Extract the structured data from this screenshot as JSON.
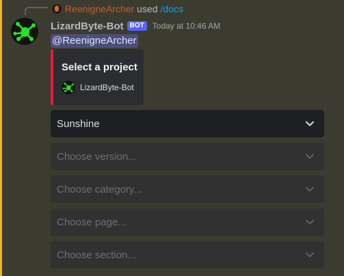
{
  "reply": {
    "user": "ReenigneArcher",
    "used_label": "used",
    "command": "/docs"
  },
  "message": {
    "username": "LizardByte-Bot",
    "bot_tag": "BOT",
    "timestamp": "Today at 10:46 AM",
    "mention": "@ReenigneArcher"
  },
  "embed": {
    "title": "Select a project",
    "footer_text": "LizardByte-Bot",
    "accent_color": "#e8193d"
  },
  "selects": [
    {
      "text": "Sunshine",
      "state": "selected"
    },
    {
      "text": "Choose version...",
      "state": "disabled"
    },
    {
      "text": "Choose category...",
      "state": "disabled"
    },
    {
      "text": "Choose page...",
      "state": "disabled"
    },
    {
      "text": "Choose section...",
      "state": "disabled"
    }
  ],
  "colors": {
    "bot_tag": "#5865f2",
    "command_link": "#00a8fc",
    "highlight_bar": "#f0b232"
  }
}
